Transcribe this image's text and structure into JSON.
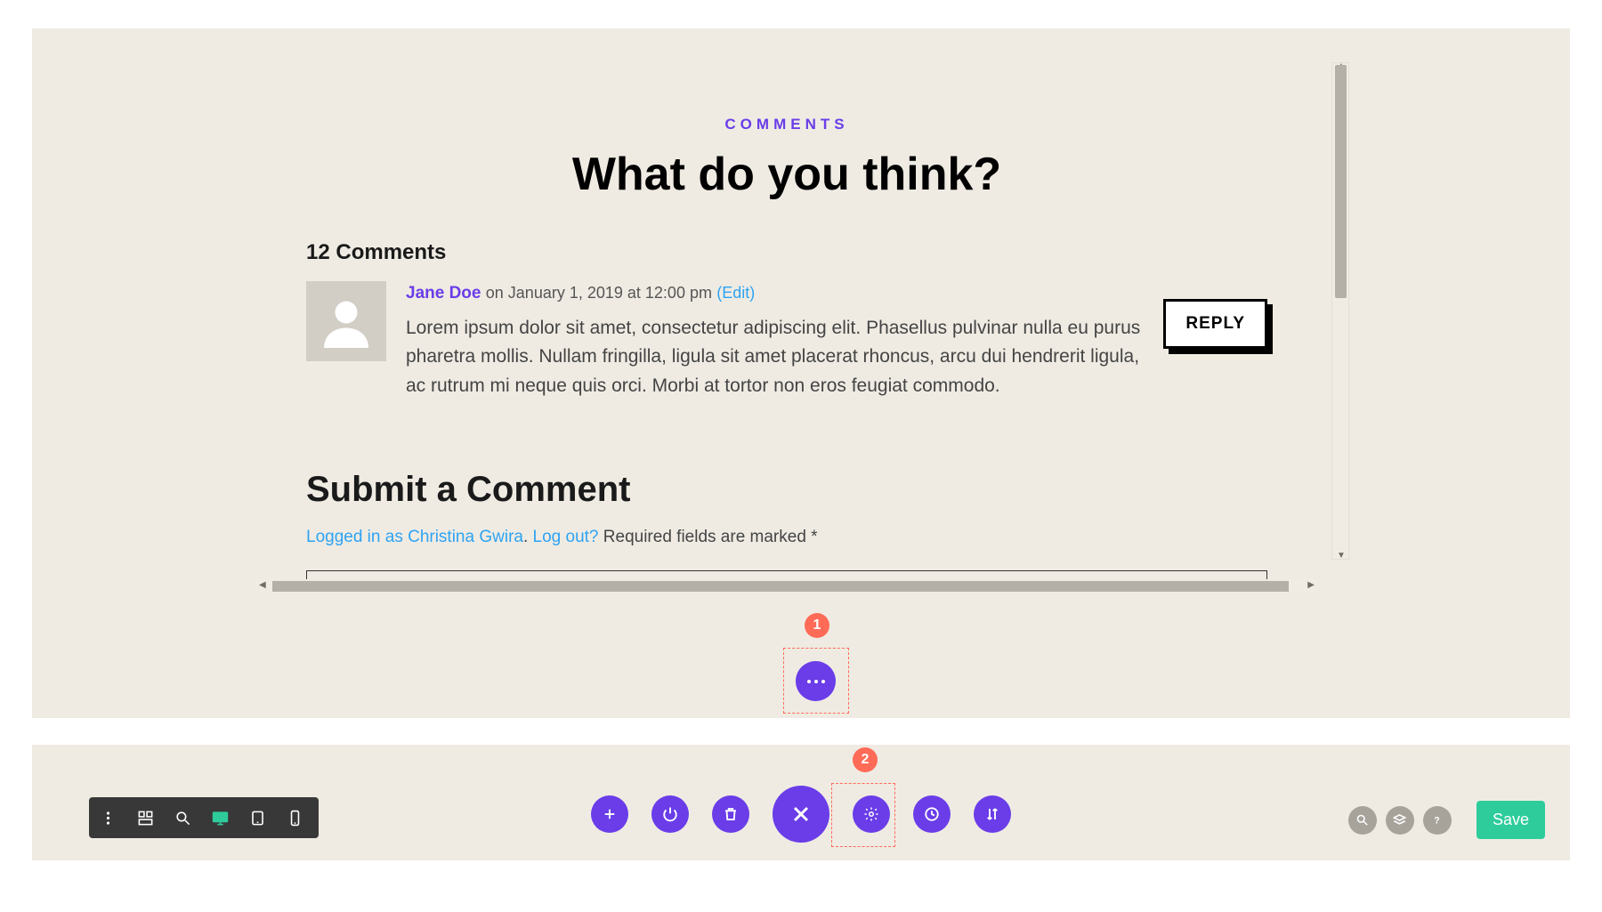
{
  "section": {
    "label": "COMMENTS",
    "title": "What do you think?"
  },
  "comments": {
    "count_label": "12 Comments",
    "first": {
      "author": "Jane Doe",
      "date_prefix": "on ",
      "date": "January 1, 2019 at 12:00 pm",
      "edit_label": "(Edit)",
      "body": "Lorem ipsum dolor sit amet, consectetur adipiscing elit. Phasellus pulvinar nulla eu purus pharetra mollis. Nullam fringilla, ligula sit amet placerat rhoncus, arcu dui hendrerit ligula, ac rutrum mi neque quis orci. Morbi at tortor non eros feugiat commodo.",
      "reply_label": "REPLY"
    }
  },
  "submit": {
    "title": "Submit a Comment",
    "logged_in_prefix": "Logged in as ",
    "user": "Christina Gwira",
    "period": ". ",
    "logout_label": "Log out?",
    "required_note": " Required fields are marked *"
  },
  "annotations": {
    "one": "1",
    "two": "2"
  },
  "toolbar": {
    "save_label": "Save"
  }
}
